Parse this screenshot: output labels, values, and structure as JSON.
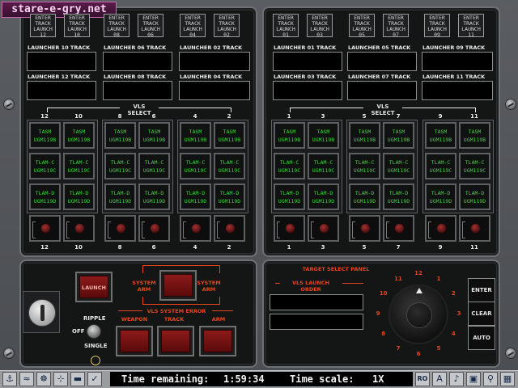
{
  "logo": "stare-e-gry.net",
  "enter_buttons_left": [
    {
      "l1": "ENTER",
      "l2": "TRACK",
      "l3": "LAUNCH",
      "num": "12"
    },
    {
      "l1": "ENTER",
      "l2": "TRACK",
      "l3": "LAUNCH",
      "num": "10"
    },
    {
      "l1": "ENTER",
      "l2": "TRACK",
      "l3": "LAUNCH",
      "num": "08"
    },
    {
      "l1": "ENTER",
      "l2": "TRACK",
      "l3": "LAUNCH",
      "num": "06"
    },
    {
      "l1": "ENTER",
      "l2": "TRACK",
      "l3": "LAUNCH",
      "num": "04"
    },
    {
      "l1": "ENTER",
      "l2": "TRACK",
      "l3": "LAUNCH",
      "num": "02"
    }
  ],
  "enter_buttons_right": [
    {
      "l1": "ENTER",
      "l2": "TRACK",
      "l3": "LAUNCH",
      "num": "01"
    },
    {
      "l1": "ENTER",
      "l2": "TRACK",
      "l3": "LAUNCH",
      "num": "03"
    },
    {
      "l1": "ENTER",
      "l2": "TRACK",
      "l3": "LAUNCH",
      "num": "05"
    },
    {
      "l1": "ENTER",
      "l2": "TRACK",
      "l3": "LAUNCH",
      "num": "07"
    },
    {
      "l1": "ENTER",
      "l2": "TRACK",
      "l3": "LAUNCH",
      "num": "09"
    },
    {
      "l1": "ENTER",
      "l2": "TRACK",
      "l3": "LAUNCH",
      "num": "11"
    }
  ],
  "track_labels_left": [
    "LAUNCHER 10 TRACK",
    "LAUNCHER 06 TRACK",
    "LAUNCHER 02 TRACK",
    "LAUNCHER 12 TRACK",
    "LAUNCHER 08 TRACK",
    "LAUNCHER 04 TRACK"
  ],
  "track_labels_right": [
    "LAUNCHER 01 TRACK",
    "LAUNCHER 05 TRACK",
    "LAUNCHER 09 TRACK",
    "LAUNCHER 03 TRACK",
    "LAUNCHER 07 TRACK",
    "LAUNCHER 11 TRACK"
  ],
  "vls_select_label": "VLS SELECT",
  "vls_numbers_left": [
    "12",
    "10",
    "8",
    "6",
    "4",
    "2"
  ],
  "vls_numbers_right": [
    "1",
    "3",
    "5",
    "7",
    "9",
    "11"
  ],
  "missiles": {
    "tasm": {
      "l1": "TASM",
      "l2": "UGM119B"
    },
    "tlamc": {
      "l1": "TLAM-C",
      "l2": "UGM119C"
    },
    "tlamd": {
      "l1": "TLAM-D",
      "l2": "UGM119D"
    }
  },
  "bottom_left": {
    "launch": "LAUNCH",
    "system_arm_left": "SYSTEM ARM",
    "system_arm_right": "SYSTEM ARM",
    "ripple": "RIPPLE",
    "off": "OFF",
    "single": "SINGLE",
    "error_title": "VLS SYSTEM ERROR",
    "weapon": "WEAPON",
    "track": "TRACK",
    "arm": "ARM"
  },
  "target_panel": {
    "title": "TARGET SELECT PANEL",
    "order_title_1": "VLS LAUNCH",
    "order_title_2": "ORDER",
    "dial_numbers": [
      "1",
      "2",
      "3",
      "4",
      "5",
      "6",
      "7",
      "8",
      "9",
      "10",
      "11",
      "12"
    ],
    "enter": "ENTER",
    "clear": "CLEAR",
    "auto": "AUTO"
  },
  "status": {
    "time_remaining_label": "Time remaining:",
    "time_remaining_value": "1:59:34",
    "time_scale_label": "Time scale:",
    "time_scale_value": "1X",
    "ro": "RO"
  },
  "colors": {
    "accent": "#e8441c",
    "missile_text": "#3fd23f",
    "lamp": "#8d1a1a"
  }
}
